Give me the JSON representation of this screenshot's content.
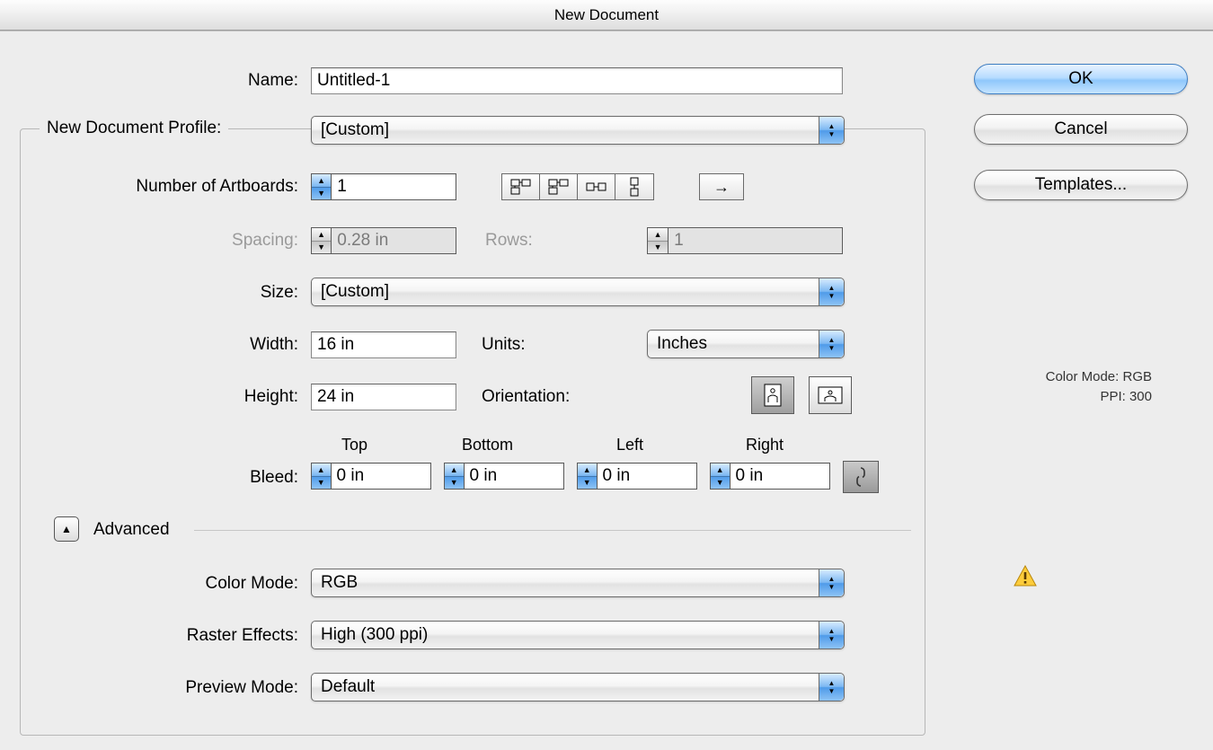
{
  "window": {
    "title": "New Document"
  },
  "buttons": {
    "ok": "OK",
    "cancel": "Cancel",
    "templates": "Templates..."
  },
  "fields": {
    "name": {
      "label": "Name:",
      "value": "Untitled-1"
    },
    "profile": {
      "label": "New Document Profile:",
      "value": "[Custom]"
    },
    "artboards": {
      "label": "Number of Artboards:",
      "value": "1"
    },
    "spacing": {
      "label": "Spacing:",
      "value": "0.28 in"
    },
    "rows": {
      "label": "Rows:",
      "value": "1"
    },
    "size": {
      "label": "Size:",
      "value": "[Custom]"
    },
    "width": {
      "label": "Width:",
      "value": "16 in"
    },
    "height": {
      "label": "Height:",
      "value": "24 in"
    },
    "units": {
      "label": "Units:",
      "value": "Inches"
    },
    "orientation": {
      "label": "Orientation:"
    },
    "bleed": {
      "label": "Bleed:",
      "top_label": "Top",
      "top": "0 in",
      "bottom_label": "Bottom",
      "bottom": "0 in",
      "left_label": "Left",
      "left": "0 in",
      "right_label": "Right",
      "right": "0 in"
    },
    "advanced": {
      "label": "Advanced"
    },
    "color_mode": {
      "label": "Color Mode:",
      "value": "RGB"
    },
    "raster": {
      "label": "Raster Effects:",
      "value": "High (300 ppi)"
    },
    "preview": {
      "label": "Preview Mode:",
      "value": "Default"
    }
  },
  "info": {
    "color_mode_label": "Color Mode:",
    "color_mode_value": "RGB",
    "ppi_label": "PPI:",
    "ppi_value": "300"
  }
}
